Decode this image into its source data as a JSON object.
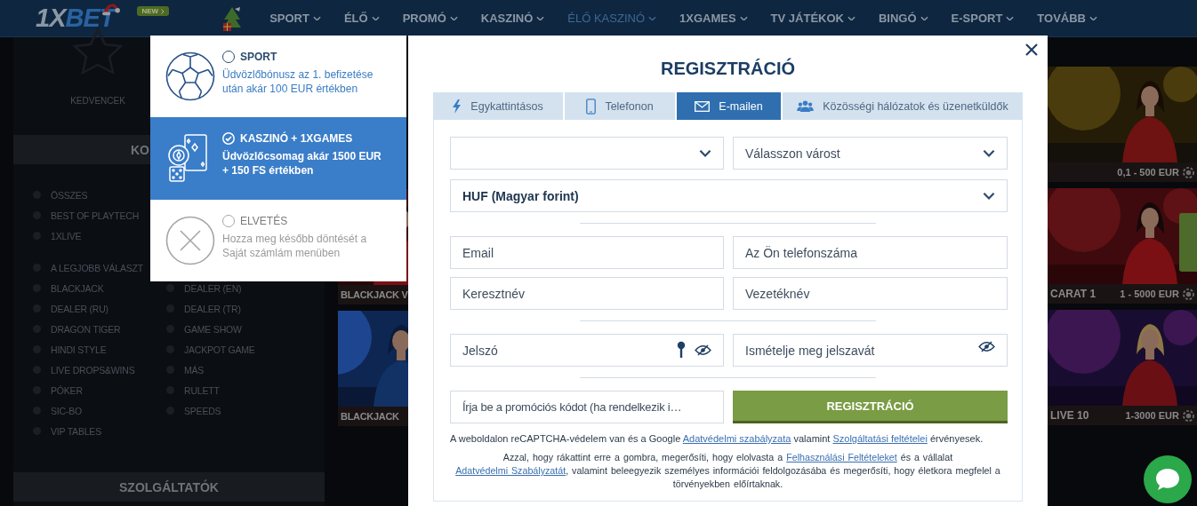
{
  "header": {
    "logo": "1XBET",
    "new_badge": "NEW",
    "nav": [
      {
        "label": "SPORT",
        "selected": false
      },
      {
        "label": "ÉLŐ",
        "selected": false
      },
      {
        "label": "PROMÓ",
        "selected": false
      },
      {
        "label": "KASZINÓ",
        "selected": false
      },
      {
        "label": "ÉLŐ KASZINÓ",
        "selected": true
      },
      {
        "label": "1XGAMES",
        "selected": false
      },
      {
        "label": "TV JÁTÉKOK",
        "selected": false
      },
      {
        "label": "BINGÓ",
        "selected": false
      },
      {
        "label": "E-SPORT",
        "selected": false
      },
      {
        "label": "TOVÁBB",
        "selected": false
      }
    ]
  },
  "sidebar": {
    "favorites_label": "KEDVENCEK",
    "categories_header": "KO",
    "group_1": [
      "ÖSSZES",
      "BEST OF PLAYTECH",
      "1XLIVE"
    ],
    "group_2_column_1": [
      "A LEGJOBB VÁLASZT",
      "BLACKJACK",
      "DEALER (RU)",
      "DRAGON TIGER",
      "HINDI STYLE",
      "LIVE DROPS&WINS",
      "PÓKER",
      "SIC-BO",
      "VIP TABLES"
    ],
    "group_2_column_2": [
      "DEALER (EN)",
      "DEALER (TR)",
      "GAME SHOW",
      "JACKPOT GAME",
      "MÁS",
      "RULETT",
      "SPEEDS"
    ],
    "providers_header": "SZOLGÁLTATÓK"
  },
  "game_cards_left": [
    {
      "title": "BLACKJACK V"
    },
    {
      "title": "BLACKJACK"
    }
  ],
  "game_cards_right": [
    {
      "limits": "0,1 - 500 EUR"
    },
    {
      "title": "CARAT 1",
      "limits": "1 - 5000 EUR"
    },
    {
      "title": "LIVE 10",
      "limits": "1-3000 EUR"
    }
  ],
  "bonus_options": [
    {
      "kind": "sport",
      "title": "SPORT",
      "description": "Üdvözlőbónusz az 1. befizetése után akár 100 EUR értékben",
      "selected": false
    },
    {
      "kind": "casino",
      "title": "KASZINÓ + 1XGAMES",
      "description": "Üdvözlőcsomag akár 1500 EUR + 150 FS értékben",
      "selected": true
    },
    {
      "kind": "decline",
      "title": "ELVETÉS",
      "description": "Hozza meg később döntését a Saját számlám menüben",
      "selected": false
    }
  ],
  "registration": {
    "title": "REGISZTRÁCIÓ",
    "tabs": [
      {
        "kind": "one-click",
        "label": "Egykattintásos",
        "selected": false
      },
      {
        "kind": "phone",
        "label": "Telefonon",
        "selected": false
      },
      {
        "kind": "email",
        "label": "E-mailen",
        "selected": true
      },
      {
        "kind": "social",
        "label": "Közösségi hálózatok és üzenetküldők",
        "selected": false
      }
    ],
    "city_select": {
      "placeholder": "Válasszon várost"
    },
    "currency_select": {
      "value": "HUF (Magyar forint)"
    },
    "email_field": {
      "placeholder": "Email"
    },
    "phone_field": {
      "placeholder": "Az Ön telefonszáma"
    },
    "first_name_field": {
      "placeholder": "Keresztnév"
    },
    "last_name_field": {
      "placeholder": "Vezetéknév"
    },
    "password_field": {
      "placeholder": "Jelszó"
    },
    "repeat_password_field": {
      "placeholder": "Ismételje meg jelszavát"
    },
    "promo_code_field": {
      "placeholder": "Írja be a promóciós kódot (ha rendelkezik i…"
    },
    "submit_button": "REGISZTRÁCIÓ",
    "recaptcha_notice": [
      {
        "kind": "text",
        "text": "A weboldalon reCAPTCHA-védelem van és a Google "
      },
      {
        "kind": "link",
        "text": "Adatvédelmi szabályzata"
      },
      {
        "kind": "text",
        "text": " valamint "
      },
      {
        "kind": "link",
        "text": "Szolgáltatási feltételei"
      },
      {
        "kind": "text",
        "text": " érvényesek."
      }
    ],
    "consent_notice": [
      {
        "kind": "text",
        "text": "Azzal, hogy rákattint erre a gombra, megerősíti, hogy elolvasta a "
      },
      {
        "kind": "link",
        "text": "Felhasználási Feltételeket"
      },
      {
        "kind": "text",
        "text": " és a vállalat "
      },
      {
        "kind": "link",
        "text": "Adatvédelmi Szabályzatát"
      },
      {
        "kind": "text",
        "text": ", valamint beleegyezik személyes információi feldolgozásába és megerősíti, hogy életkora megfelel a törvényekben előírtaknak."
      }
    ]
  }
}
